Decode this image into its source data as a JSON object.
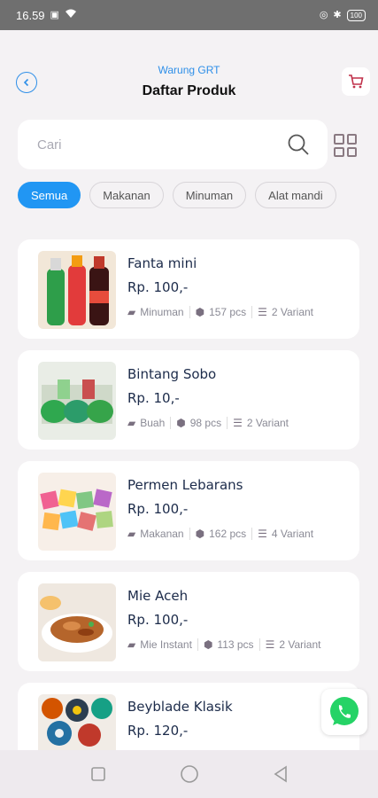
{
  "status_bar": {
    "time": "16.59",
    "battery": "100"
  },
  "header": {
    "store_name": "Warung GRT",
    "title": "Daftar Produk"
  },
  "search": {
    "placeholder": "Cari"
  },
  "filters": [
    {
      "label": "Semua",
      "active": true
    },
    {
      "label": "Makanan",
      "active": false
    },
    {
      "label": "Minuman",
      "active": false
    },
    {
      "label": "Alat mandi",
      "active": false
    }
  ],
  "products": [
    {
      "name": "Fanta mini",
      "price": "Rp. 100,-",
      "category": "Minuman",
      "stock": "157 pcs",
      "variants": "2 Variant",
      "image": "soda-bottles"
    },
    {
      "name": "Bintang Sobo",
      "price": "Rp. 10,-",
      "category": "Buah",
      "stock": "98 pcs",
      "variants": "2 Variant",
      "image": "green-dessert-cups"
    },
    {
      "name": "Permen Lebarans",
      "price": "Rp. 100,-",
      "category": "Makanan",
      "stock": "162 pcs",
      "variants": "4 Variant",
      "image": "colorful-candies"
    },
    {
      "name": "Mie Aceh",
      "price": "Rp. 100,-",
      "category": "Mie Instant",
      "stock": "113 pcs",
      "variants": "2 Variant",
      "image": "fried-noodles"
    },
    {
      "name": "Beyblade Klasik",
      "price": "Rp. 120,-",
      "category": "",
      "stock": "",
      "variants": "",
      "image": "beyblade-toys"
    }
  ],
  "colors": {
    "accent": "#2196f3",
    "cart": "#c0304a",
    "whatsapp": "#25d366"
  }
}
